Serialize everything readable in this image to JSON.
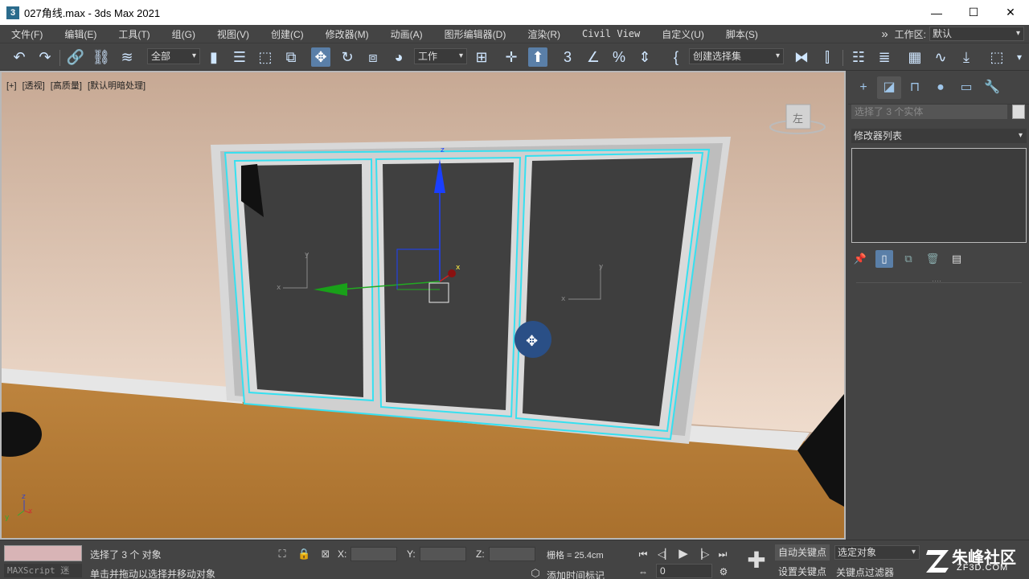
{
  "window": {
    "app_icon": "3",
    "title": "027角线.max - 3ds Max 2021",
    "minimize": "—",
    "maximize": "☐",
    "close": "✕"
  },
  "menu": {
    "items": [
      "文件(F)",
      "编辑(E)",
      "工具(T)",
      "组(G)",
      "视图(V)",
      "创建(C)",
      "修改器(M)",
      "动画(A)",
      "图形编辑器(D)",
      "渲染(R)",
      "Civil View",
      "自定义(U)",
      "脚本(S)"
    ],
    "overflow": "»",
    "workspace_label": "工作区:",
    "workspace_value": "默认"
  },
  "toolbar": {
    "filter_value": "全部",
    "ref_coord_value": "工作",
    "named_selection_value": "创建选择集"
  },
  "viewport": {
    "label_plus": "[+]",
    "label_view": "[透视]",
    "label_shading": "[高质量]",
    "label_lighting": "[默认明暗处理]",
    "viewcube_label": "左",
    "gizmo_x": "x",
    "gizmo_y": "y",
    "gizmo_z": "z",
    "pivot_y1": "y",
    "pivot_x1": "x",
    "pivot_y2": "y",
    "pivot_x2": "x",
    "world_axis_x": "x",
    "world_axis_y": "y",
    "world_axis_z": "z"
  },
  "command_panel": {
    "selection_info": "选择了 3 个实体",
    "modifier_list": "修改器列表",
    "handle": "····"
  },
  "status": {
    "maxscript_label": "MAXScript 迷",
    "selection_msg": "选择了 3 个 对象",
    "prompt_msg": "单击并拖动以选择并移动对象",
    "x_label": "X:",
    "y_label": "Y:",
    "z_label": "Z:",
    "grid": "栅格 = 25.4cm",
    "add_time_tag": "添加时间标记",
    "current_frame": "0",
    "auto_key": "自动关键点",
    "set_key": "设置关键点",
    "selected_objects": "选定对象",
    "key_filters": "关键点过滤器"
  },
  "watermark": {
    "name": "朱峰社区",
    "url": "ZF3D.COM"
  }
}
